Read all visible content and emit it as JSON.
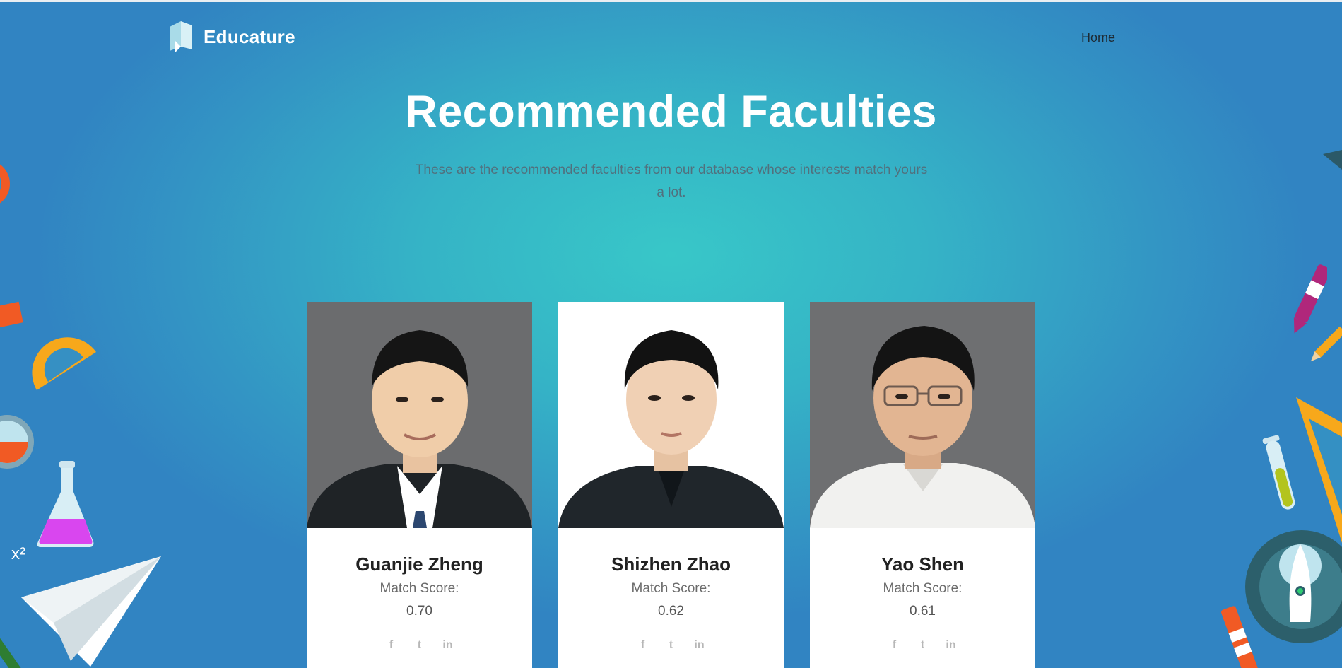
{
  "header": {
    "brand": "Educature",
    "nav": {
      "home": "Home"
    }
  },
  "hero": {
    "title": "Recommended Faculties",
    "subtitle": "These are the recommended faculties from our database whose interests match yours a lot."
  },
  "faculties": [
    {
      "name": "Guanjie Zheng",
      "score_label": "Match Score:",
      "score": "0.70",
      "photo_bg": "#6b6c6e",
      "shirt": "#1f2326"
    },
    {
      "name": "Shizhen Zhao",
      "score_label": "Match Score:",
      "score": "0.62",
      "photo_bg": "#ffffff",
      "shirt": "#20262b"
    },
    {
      "name": "Yao Shen",
      "score_label": "Match Score:",
      "score": "0.61",
      "photo_bg": "#6e6f71",
      "shirt": "#f1f1ef"
    }
  ],
  "socials": {
    "facebook": "f",
    "twitter": "t",
    "linkedin": "in"
  },
  "decorations": {
    "superscript": "x²"
  },
  "colors": {
    "accent": "#38c7c8",
    "background": "#3184c2",
    "card": "#ffffff"
  }
}
